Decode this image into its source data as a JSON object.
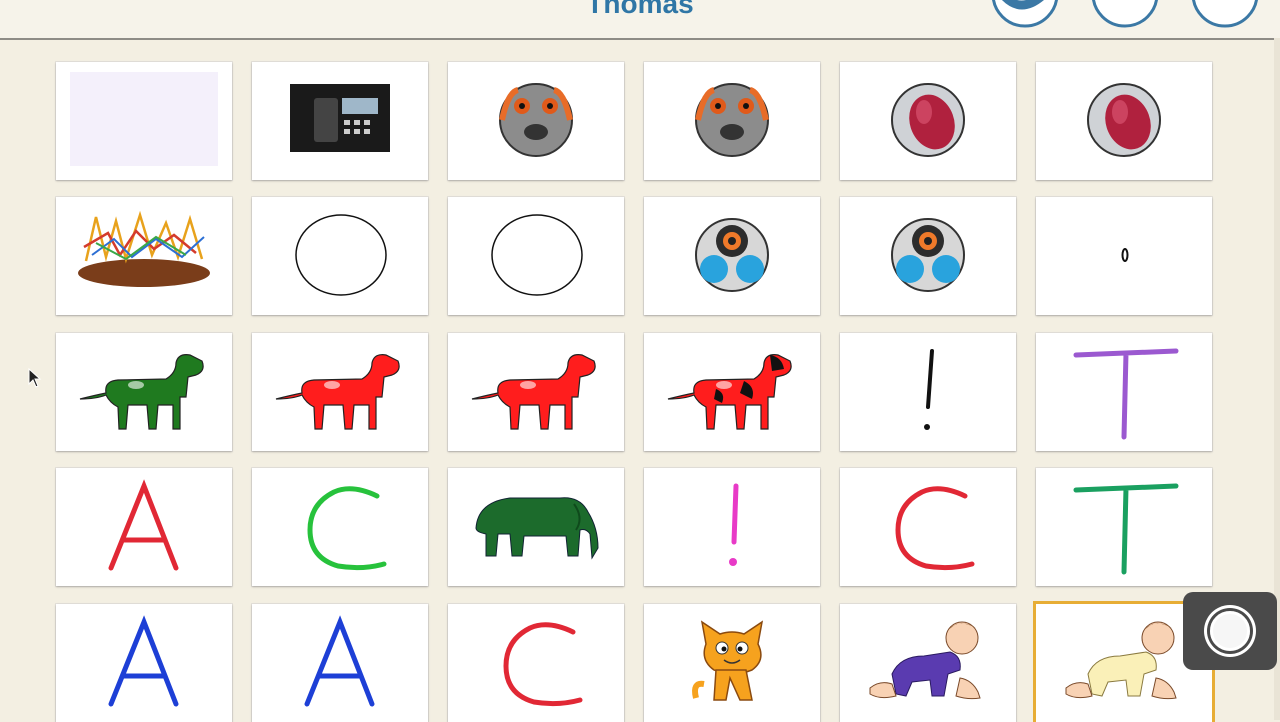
{
  "header": {
    "title": "Thomas",
    "buttons": [
      {
        "name": "paint-icon"
      },
      {
        "name": "edit-icon"
      },
      {
        "name": "close-icon"
      }
    ]
  },
  "grid": {
    "rows": [
      [
        "blank-lavender-card",
        "desk-phone-photo",
        "plush-toy-photo",
        "plush-toy-photo",
        "red-mouse-photo",
        "red-mouse-photo"
      ],
      [
        "scribble-drawing",
        "empty-circle",
        "empty-circle",
        "robot-photo",
        "robot-photo",
        "small-zero"
      ],
      [
        "green-dog",
        "red-dog",
        "red-dog",
        "red-black-dog",
        "exclamation-mark",
        "purple-letter-t"
      ],
      [
        "red-letter-a",
        "green-letter-c",
        "green-elephant",
        "pink-exclamation",
        "red-letter-c",
        "green-letter-t"
      ],
      [
        "blue-letter-a",
        "blue-letter-a",
        "red-letter-c",
        "scratch-cat",
        "baby-purple",
        "baby-yellow"
      ]
    ],
    "selected": "baby-yellow"
  },
  "colors": {
    "title": "#2f76a6",
    "background": "#f3efe2",
    "selection": "#e7ad35"
  }
}
